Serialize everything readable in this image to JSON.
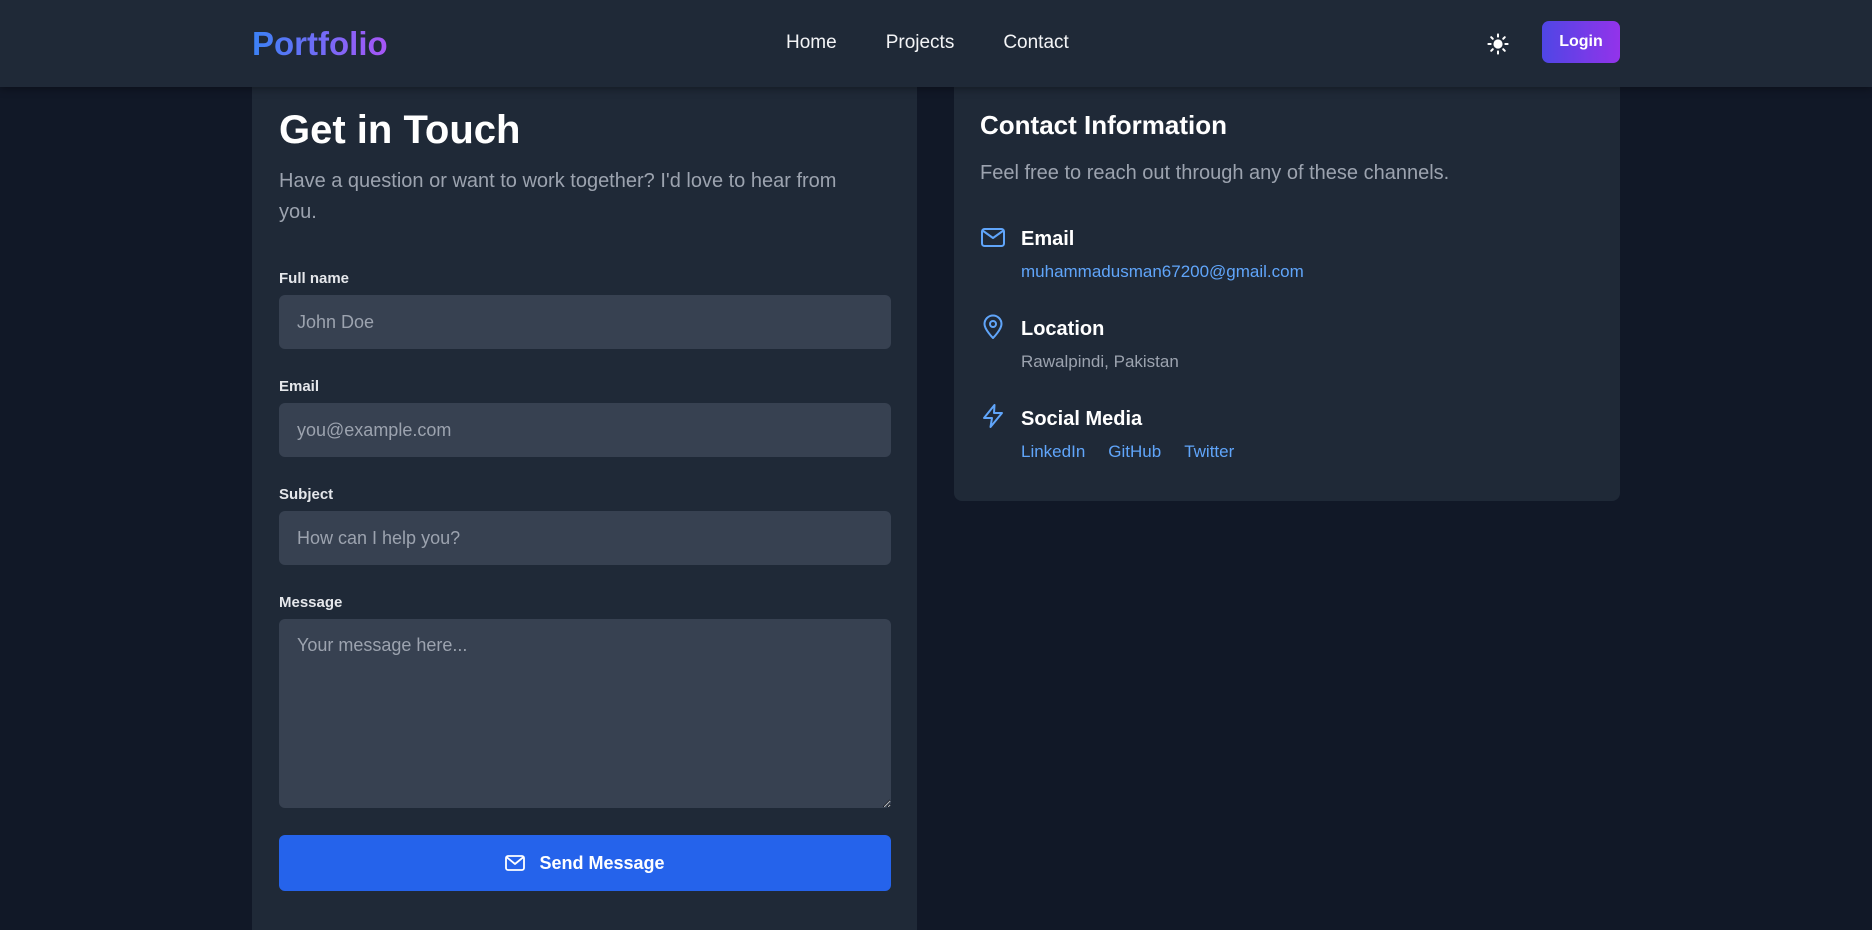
{
  "header": {
    "logo": "Portfolio",
    "nav": [
      "Home",
      "Projects",
      "Contact"
    ],
    "theme_icon": "sun-icon",
    "login_label": "Login"
  },
  "form": {
    "title": "Get in Touch",
    "subtitle": "Have a question or want to work together? I'd love to hear from you.",
    "fields": {
      "name": {
        "label": "Full name",
        "placeholder": "John Doe"
      },
      "email": {
        "label": "Email",
        "placeholder": "you@example.com"
      },
      "subject": {
        "label": "Subject",
        "placeholder": "How can I help you?"
      },
      "message": {
        "label": "Message",
        "placeholder": "Your message here..."
      }
    },
    "submit_label": "Send Message",
    "submit_icon": "mail-icon"
  },
  "contact": {
    "title": "Contact Information",
    "subtitle": "Feel free to reach out through any of these channels.",
    "email": {
      "label": "Email",
      "value": "muhammadusman67200@gmail.com",
      "icon": "mail-icon"
    },
    "location": {
      "label": "Location",
      "value": "Rawalpindi, Pakistan",
      "icon": "map-pin-icon"
    },
    "social": {
      "label": "Social Media",
      "icon": "lightning-icon",
      "links": [
        "LinkedIn",
        "GitHub",
        "Twitter"
      ]
    }
  },
  "colors": {
    "background": "#111827",
    "card": "#1f2937",
    "input": "#374151",
    "primary": "#2563eb",
    "link": "#60a5fa",
    "logo_gradient_start": "#3b82f6",
    "logo_gradient_end": "#a855f7"
  }
}
